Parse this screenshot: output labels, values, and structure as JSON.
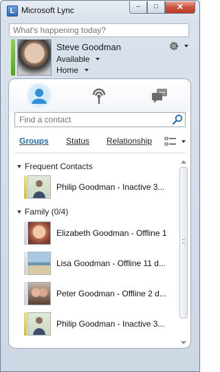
{
  "window": {
    "title": "Microsoft Lync",
    "app_icon_letter": "L",
    "minimize_glyph": "–",
    "maximize_glyph": "□",
    "close_glyph": "✕"
  },
  "personal_note": {
    "placeholder": "What's happening today?"
  },
  "profile": {
    "name": "Steve Goodman",
    "status": "Available",
    "location": "Home",
    "presence_color": "#5cb21f"
  },
  "search": {
    "placeholder": "Find a contact"
  },
  "view_tabs": {
    "groups": "Groups",
    "status": "Status",
    "relationship": "Relationship"
  },
  "groups": [
    {
      "title": "Frequent Contacts",
      "contacts": [
        {
          "name": "Philip Goodman - Inactive 3...",
          "state": "inactive",
          "photo_icon": "person-photo"
        }
      ]
    },
    {
      "title": "Family (0/4)",
      "contacts": [
        {
          "name": "Elizabeth Goodman  - Offline 1",
          "state": "offline",
          "photo_icon": "child-photo"
        },
        {
          "name": "Lisa Goodman - Offline 11 d...",
          "state": "offline",
          "photo_icon": "beach-photo"
        },
        {
          "name": "Peter Goodman - Offline 2 d...",
          "state": "offline",
          "photo_icon": "couple-photo"
        },
        {
          "name": "Philip Goodman - Inactive 3...",
          "state": "inactive",
          "photo_icon": "person-photo"
        }
      ]
    }
  ],
  "colors": {
    "accent_blue": "#1c6fb3",
    "inactive_yellow": "#e8cc45",
    "available_green": "#5cb21f"
  }
}
